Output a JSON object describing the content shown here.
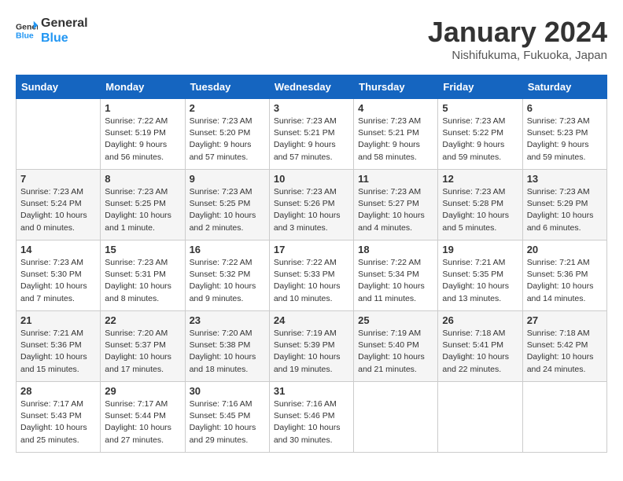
{
  "logo": {
    "line1": "General",
    "line2": "Blue"
  },
  "title": "January 2024",
  "location": "Nishifukuma, Fukuoka, Japan",
  "days_of_week": [
    "Sunday",
    "Monday",
    "Tuesday",
    "Wednesday",
    "Thursday",
    "Friday",
    "Saturday"
  ],
  "weeks": [
    [
      {
        "day": null
      },
      {
        "day": 1,
        "sunrise": "7:22 AM",
        "sunset": "5:19 PM",
        "daylight": "9 hours and 56 minutes."
      },
      {
        "day": 2,
        "sunrise": "7:23 AM",
        "sunset": "5:20 PM",
        "daylight": "9 hours and 57 minutes."
      },
      {
        "day": 3,
        "sunrise": "7:23 AM",
        "sunset": "5:21 PM",
        "daylight": "9 hours and 57 minutes."
      },
      {
        "day": 4,
        "sunrise": "7:23 AM",
        "sunset": "5:21 PM",
        "daylight": "9 hours and 58 minutes."
      },
      {
        "day": 5,
        "sunrise": "7:23 AM",
        "sunset": "5:22 PM",
        "daylight": "9 hours and 59 minutes."
      },
      {
        "day": 6,
        "sunrise": "7:23 AM",
        "sunset": "5:23 PM",
        "daylight": "9 hours and 59 minutes."
      }
    ],
    [
      {
        "day": 7,
        "sunrise": "7:23 AM",
        "sunset": "5:24 PM",
        "daylight": "10 hours and 0 minutes."
      },
      {
        "day": 8,
        "sunrise": "7:23 AM",
        "sunset": "5:25 PM",
        "daylight": "10 hours and 1 minute."
      },
      {
        "day": 9,
        "sunrise": "7:23 AM",
        "sunset": "5:25 PM",
        "daylight": "10 hours and 2 minutes."
      },
      {
        "day": 10,
        "sunrise": "7:23 AM",
        "sunset": "5:26 PM",
        "daylight": "10 hours and 3 minutes."
      },
      {
        "day": 11,
        "sunrise": "7:23 AM",
        "sunset": "5:27 PM",
        "daylight": "10 hours and 4 minutes."
      },
      {
        "day": 12,
        "sunrise": "7:23 AM",
        "sunset": "5:28 PM",
        "daylight": "10 hours and 5 minutes."
      },
      {
        "day": 13,
        "sunrise": "7:23 AM",
        "sunset": "5:29 PM",
        "daylight": "10 hours and 6 minutes."
      }
    ],
    [
      {
        "day": 14,
        "sunrise": "7:23 AM",
        "sunset": "5:30 PM",
        "daylight": "10 hours and 7 minutes."
      },
      {
        "day": 15,
        "sunrise": "7:23 AM",
        "sunset": "5:31 PM",
        "daylight": "10 hours and 8 minutes."
      },
      {
        "day": 16,
        "sunrise": "7:22 AM",
        "sunset": "5:32 PM",
        "daylight": "10 hours and 9 minutes."
      },
      {
        "day": 17,
        "sunrise": "7:22 AM",
        "sunset": "5:33 PM",
        "daylight": "10 hours and 10 minutes."
      },
      {
        "day": 18,
        "sunrise": "7:22 AM",
        "sunset": "5:34 PM",
        "daylight": "10 hours and 11 minutes."
      },
      {
        "day": 19,
        "sunrise": "7:21 AM",
        "sunset": "5:35 PM",
        "daylight": "10 hours and 13 minutes."
      },
      {
        "day": 20,
        "sunrise": "7:21 AM",
        "sunset": "5:36 PM",
        "daylight": "10 hours and 14 minutes."
      }
    ],
    [
      {
        "day": 21,
        "sunrise": "7:21 AM",
        "sunset": "5:36 PM",
        "daylight": "10 hours and 15 minutes."
      },
      {
        "day": 22,
        "sunrise": "7:20 AM",
        "sunset": "5:37 PM",
        "daylight": "10 hours and 17 minutes."
      },
      {
        "day": 23,
        "sunrise": "7:20 AM",
        "sunset": "5:38 PM",
        "daylight": "10 hours and 18 minutes."
      },
      {
        "day": 24,
        "sunrise": "7:19 AM",
        "sunset": "5:39 PM",
        "daylight": "10 hours and 19 minutes."
      },
      {
        "day": 25,
        "sunrise": "7:19 AM",
        "sunset": "5:40 PM",
        "daylight": "10 hours and 21 minutes."
      },
      {
        "day": 26,
        "sunrise": "7:18 AM",
        "sunset": "5:41 PM",
        "daylight": "10 hours and 22 minutes."
      },
      {
        "day": 27,
        "sunrise": "7:18 AM",
        "sunset": "5:42 PM",
        "daylight": "10 hours and 24 minutes."
      }
    ],
    [
      {
        "day": 28,
        "sunrise": "7:17 AM",
        "sunset": "5:43 PM",
        "daylight": "10 hours and 25 minutes."
      },
      {
        "day": 29,
        "sunrise": "7:17 AM",
        "sunset": "5:44 PM",
        "daylight": "10 hours and 27 minutes."
      },
      {
        "day": 30,
        "sunrise": "7:16 AM",
        "sunset": "5:45 PM",
        "daylight": "10 hours and 29 minutes."
      },
      {
        "day": 31,
        "sunrise": "7:16 AM",
        "sunset": "5:46 PM",
        "daylight": "10 hours and 30 minutes."
      },
      {
        "day": null
      },
      {
        "day": null
      },
      {
        "day": null
      }
    ]
  ],
  "labels": {
    "sunrise": "Sunrise:",
    "sunset": "Sunset:",
    "daylight": "Daylight:"
  }
}
